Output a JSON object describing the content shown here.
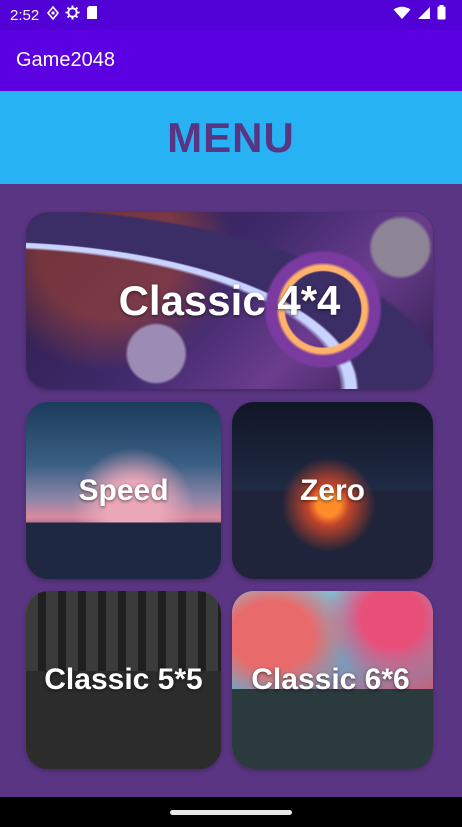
{
  "status_bar": {
    "time": "2:52",
    "left_icons": [
      "location-icon",
      "gear-icon",
      "sd-card-icon"
    ],
    "right_icons": [
      "wifi-icon",
      "signal-icon",
      "battery-icon"
    ]
  },
  "app_bar": {
    "title": "Game2048"
  },
  "menu": {
    "title": "MENU",
    "cards": [
      {
        "id": "classic4",
        "label": "Classic 4*4"
      },
      {
        "id": "speed",
        "label": "Speed"
      },
      {
        "id": "zero",
        "label": "Zero"
      },
      {
        "id": "classic5",
        "label": "Classic 5*5"
      },
      {
        "id": "classic6",
        "label": "Classic 6*6"
      }
    ]
  },
  "colors": {
    "status_bar": "#5100d6",
    "app_bar": "#5b00e0",
    "menu_header": "#27b3f3",
    "menu_title": "#5a3583",
    "background": "#5a3583"
  }
}
